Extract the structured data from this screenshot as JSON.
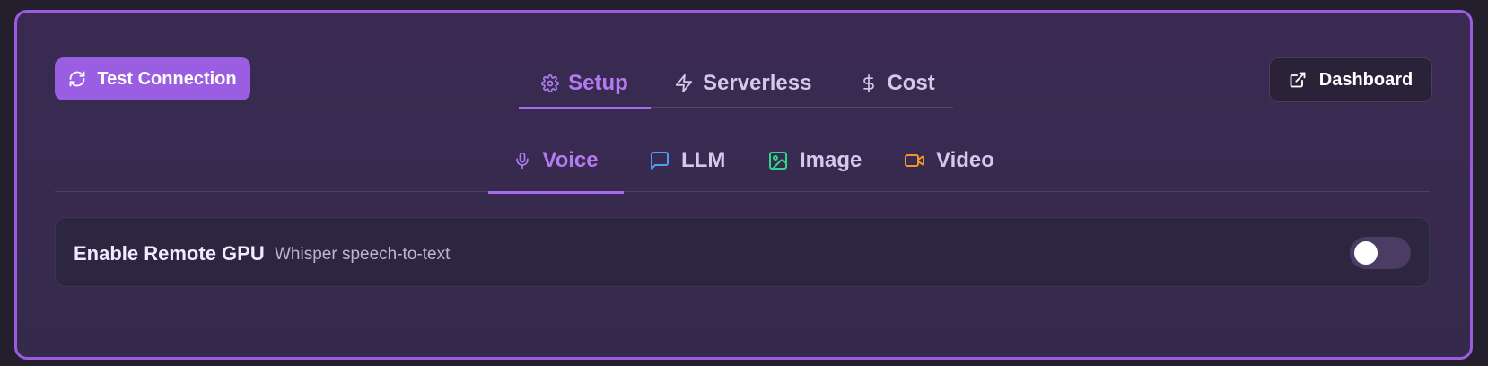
{
  "header": {
    "test_connection_label": "Test Connection",
    "dashboard_label": "Dashboard"
  },
  "top_tabs": [
    {
      "label": "Setup",
      "icon": "gear-icon",
      "active": true
    },
    {
      "label": "Serverless",
      "icon": "lightning-icon",
      "active": false
    },
    {
      "label": "Cost",
      "icon": "dollar-icon",
      "active": false
    }
  ],
  "sub_tabs": [
    {
      "label": "Voice",
      "icon": "microphone-icon",
      "active": true
    },
    {
      "label": "LLM",
      "icon": "chat-bubble-icon",
      "active": false
    },
    {
      "label": "Image",
      "icon": "image-icon",
      "active": false
    },
    {
      "label": "Video",
      "icon": "video-camera-icon",
      "active": false
    }
  ],
  "setting": {
    "title": "Enable Remote GPU",
    "subtitle": "Whisper speech-to-text",
    "enabled": false
  },
  "colors": {
    "accent": "#9a5ee3",
    "panel_border": "#9b5ce0",
    "llm_icon": "#4a9ff5",
    "image_icon": "#2fd68a",
    "video_icon": "#f0962a"
  }
}
